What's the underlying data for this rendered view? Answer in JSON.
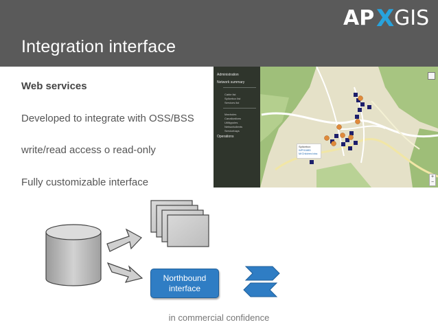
{
  "header": {
    "title": "Integration interface"
  },
  "logo": {
    "part1": "AP",
    "part2": "X",
    "part3": "GIS"
  },
  "bullets": [
    "Web services",
    "Developed to integrate with OSS/BSS",
    "write/read access o read-only",
    "Fully customizable interface"
  ],
  "map": {
    "menu": {
      "administration": "Administration",
      "network_summary": "Network summary",
      "items": [
        "Cable list",
        "Splicebox list",
        "Services list"
      ],
      "items2": [
        "Manholes",
        "Canalizations",
        "Utilitypoles",
        "Networkclients",
        "Servicebays"
      ],
      "operations": "Operations"
    },
    "popup": {
      "title": "Splicebox",
      "line1": "WP01885",
      "line2": "M/Children/otra"
    }
  },
  "diagram": {
    "interface_label_line1": "Northbound",
    "interface_label_line2": "interface"
  },
  "footer": {
    "text": "in commercial confidence"
  },
  "colors": {
    "header": "#5a5a5a",
    "accent_blue": "#2f7dc4",
    "logo_x": "#27a3dd"
  }
}
